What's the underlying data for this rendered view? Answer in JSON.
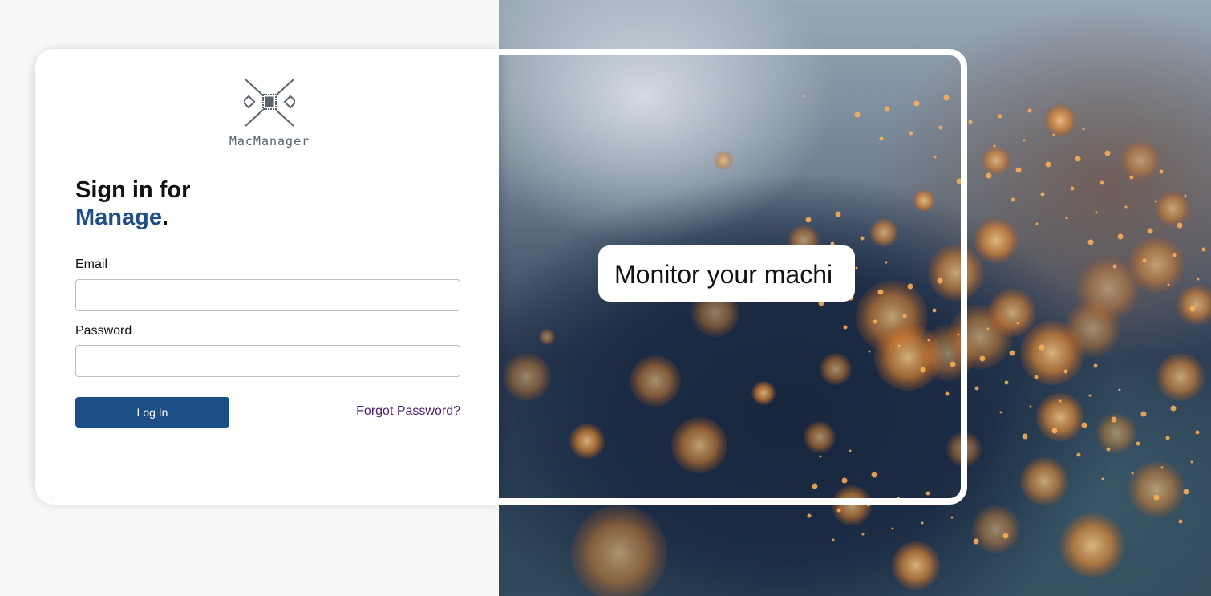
{
  "brand": {
    "name": "MacManager",
    "icon": "chip-crossed-logo-icon"
  },
  "signin": {
    "title_line1": "Sign in for",
    "title_accent": "Manage",
    "title_punct": "."
  },
  "form": {
    "email_label": "Email",
    "email_value": "",
    "email_placeholder": "",
    "password_label": "Password",
    "password_value": "",
    "password_placeholder": "",
    "login_label": "Log In",
    "forgot_label": "Forgot Password?"
  },
  "hero": {
    "tagline": "Monitor your machi",
    "image": "welding-sparks-photo"
  },
  "colors": {
    "accent": "#1f4f86",
    "button": "#1d4f87",
    "link": "#4b1f75",
    "page_bg": "#f8f8f8"
  }
}
